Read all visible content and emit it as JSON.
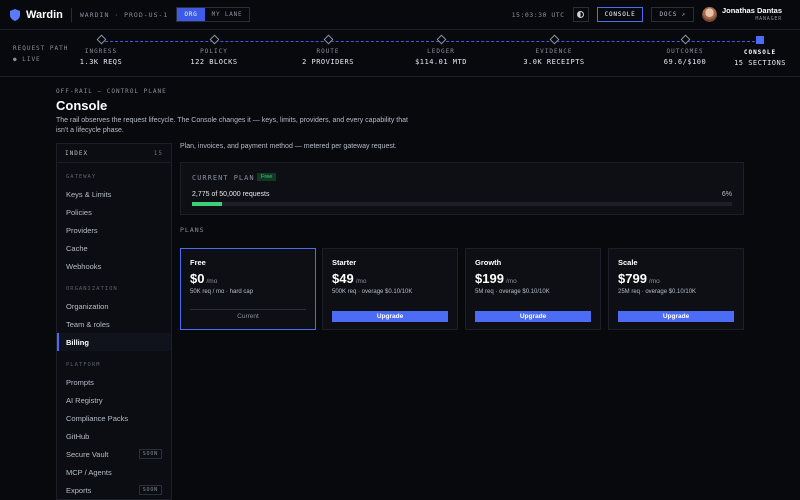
{
  "topbar": {
    "brand": "Wardin",
    "environment": "WARDIN · PROD-US-1",
    "scope_tabs": [
      {
        "label": "ORG",
        "active": true
      },
      {
        "label": "MY LANE",
        "active": false
      }
    ],
    "clock": "15:03:30 UTC",
    "console_label": "CONSOLE",
    "docs_label": "DOCS ↗",
    "user": {
      "name": "Jonathas Dantas",
      "role": "MANAGER"
    }
  },
  "rail": {
    "label": "REQUEST PATH",
    "live": "● LIVE",
    "stages": [
      {
        "name": "INGRESS",
        "value": "1.3K REQS",
        "active": false
      },
      {
        "name": "POLICY",
        "value": "122 BLOCKS",
        "active": false
      },
      {
        "name": "ROUTE",
        "value": "2 PROVIDERS",
        "active": false
      },
      {
        "name": "LEDGER",
        "value": "$114.01 MTD",
        "active": false
      },
      {
        "name": "EVIDENCE",
        "value": "3.0K RECEIPTS",
        "active": false
      },
      {
        "name": "OUTCOMES",
        "value": "69.6/$100",
        "active": false
      },
      {
        "name": "CONSOLE",
        "value": "15 SECTIONS",
        "active": true
      }
    ]
  },
  "header": {
    "eyebrow": "OFF-RAIL — CONTROL PLANE",
    "title": "Console",
    "description": "The rail observes the request lifecycle. The Console changes it — keys, limits, providers, and every capability that isn't a lifecycle phase."
  },
  "sidebar": {
    "index_label": "INDEX",
    "index_count": "15",
    "groups": [
      {
        "label": "GATEWAY",
        "items": [
          {
            "label": "Keys & Limits"
          },
          {
            "label": "Policies"
          },
          {
            "label": "Providers"
          },
          {
            "label": "Cache"
          },
          {
            "label": "Webhooks"
          }
        ]
      },
      {
        "label": "ORGANIZATION",
        "items": [
          {
            "label": "Organization"
          },
          {
            "label": "Team & roles"
          },
          {
            "label": "Billing",
            "active": true
          }
        ]
      },
      {
        "label": "PLATFORM",
        "items": [
          {
            "label": "Prompts"
          },
          {
            "label": "AI Registry"
          },
          {
            "label": "Compliance Packs"
          },
          {
            "label": "GitHub"
          },
          {
            "label": "Secure Vault",
            "badge": "SOON"
          },
          {
            "label": "MCP / Agents"
          },
          {
            "label": "Exports",
            "badge": "SOON"
          }
        ]
      }
    ]
  },
  "billing": {
    "description": "Plan, invoices, and payment method — metered per gateway request.",
    "current_plan_label": "CURRENT PLAN",
    "current_plan_badge": "Free",
    "usage_text": "2,775 of 50,000 requests",
    "usage_percent_text": "6%",
    "usage_fraction": 0.0555,
    "plans_label": "PLANS",
    "plans": [
      {
        "name": "Free",
        "price": "$0",
        "period": "/mo",
        "detail": "50K req / mo · hard cap",
        "button": "Current",
        "current": true
      },
      {
        "name": "Starter",
        "price": "$49",
        "period": "/mo",
        "detail": "500K req · overage $0.10/10K",
        "button": "Upgrade",
        "current": false
      },
      {
        "name": "Growth",
        "price": "$199",
        "period": "/mo",
        "detail": "5M req · overage $0.10/10K",
        "button": "Upgrade",
        "current": false
      },
      {
        "name": "Scale",
        "price": "$799",
        "period": "/mo",
        "detail": "25M req · overage $0.10/10K",
        "button": "Upgrade",
        "current": false
      }
    ]
  },
  "colors": {
    "accent": "#4d6cf5",
    "success": "#3ecf7a",
    "background": "#08090d"
  }
}
